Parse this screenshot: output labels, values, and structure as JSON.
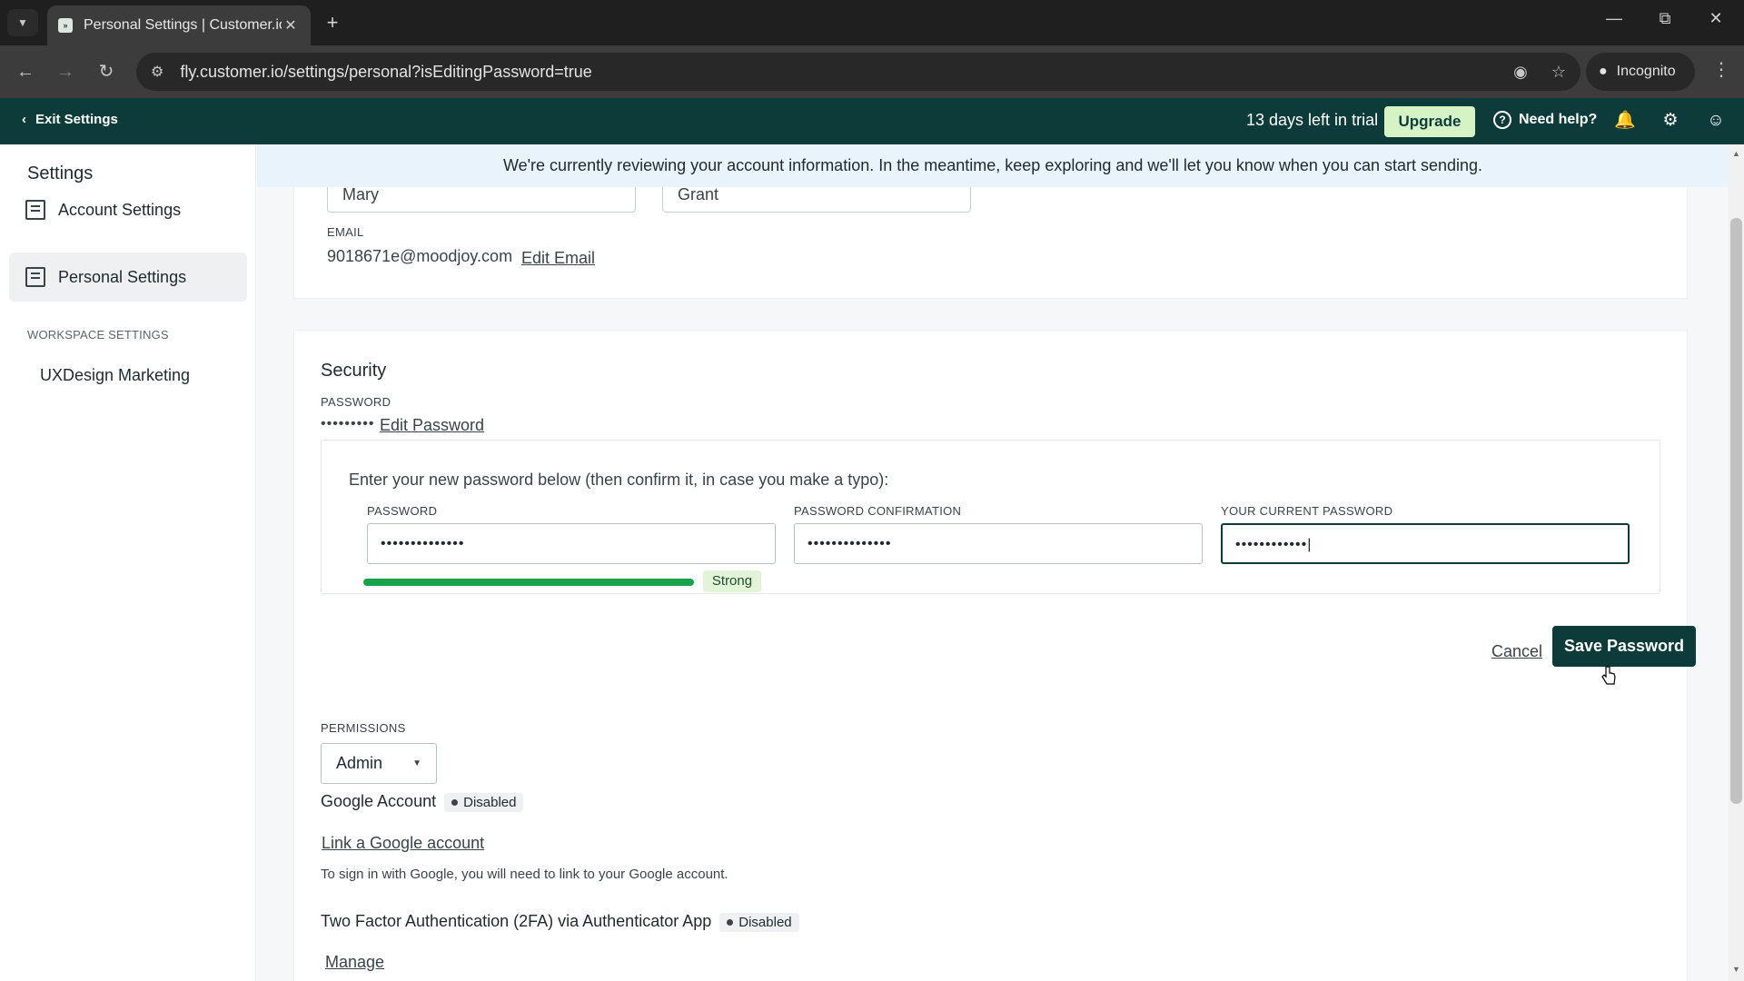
{
  "browser": {
    "tab_title": "Personal Settings | Customer.io",
    "url": "fly.customer.io/settings/personal?isEditingPassword=true",
    "incognito_label": "Incognito"
  },
  "header": {
    "exit_label": "Exit Settings",
    "trial_text": "13 days left in trial",
    "upgrade_label": "Upgrade",
    "help_label": "Need help?"
  },
  "sidebar": {
    "title": "Settings",
    "items": [
      {
        "label": "Account Settings",
        "icon": "building-icon"
      },
      {
        "label": "Personal Settings",
        "icon": "user-card-icon",
        "active": true
      }
    ],
    "workspace_section": "WORKSPACE SETTINGS",
    "workspace_item": "UXDesign Marketing"
  },
  "notice": "We're currently reviewing your account information. In the meantime, keep exploring and we'll let you know when you can start sending.",
  "profile": {
    "first_name": "Mary",
    "last_name": "Grant",
    "email_label": "EMAIL",
    "email": "9018671e@moodjoy.com",
    "edit_email_label": "Edit Email"
  },
  "security": {
    "title": "Security",
    "password_label": "PASSWORD",
    "password_mask": "•••••••••",
    "edit_password_label": "Edit Password",
    "intro": "Enter your new password below (then confirm it, in case you make a typo):",
    "fields": [
      {
        "label": "PASSWORD",
        "value": "••••••••••••••"
      },
      {
        "label": "PASSWORD CONFIRMATION",
        "value": "••••••••••••••"
      },
      {
        "label": "YOUR CURRENT PASSWORD",
        "value": "••••••••••••|"
      }
    ],
    "strength_label": "Strong",
    "strength_fraction": 1.0,
    "cancel_label": "Cancel",
    "save_label": "Save Password"
  },
  "permissions": {
    "label": "PERMISSIONS",
    "value": "Admin"
  },
  "google": {
    "title": "Google Account",
    "status": "Disabled",
    "link_label": "Link a Google account",
    "help_text": "To sign in with Google, you will need to link to your Google account."
  },
  "twofa": {
    "title": "Two Factor Authentication (2FA) via Authenticator App",
    "status": "Disabled",
    "manage_label": "Manage"
  },
  "colors": {
    "brand": "#0c3b3a",
    "upgrade_bg": "#d6f3c6",
    "strength": "#16a34a"
  }
}
